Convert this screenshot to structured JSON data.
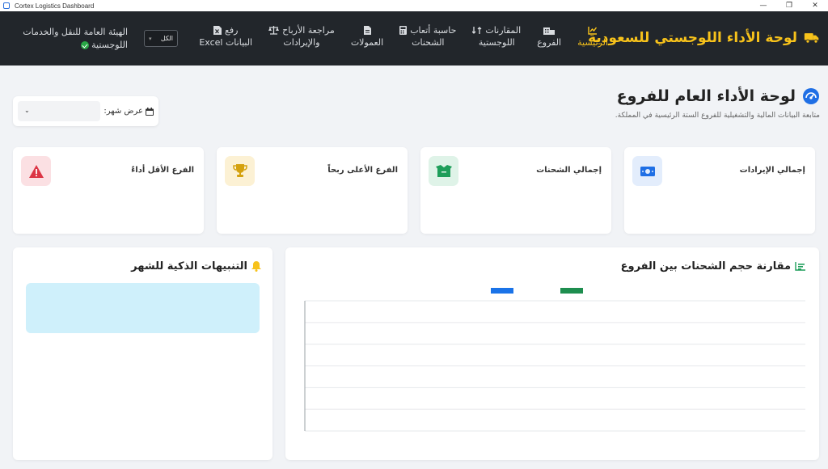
{
  "window": {
    "title": "Cortex Logistics Dashboard",
    "minimize": "—",
    "maximize": "❐",
    "close": "✕"
  },
  "header": {
    "brand_title": "لوحة الأداء اللوجستي للسعودية",
    "brand_icon": "truck-icon",
    "nav": [
      {
        "label": "الرئيسية",
        "icon": "chart-line-icon",
        "active": true
      },
      {
        "label": "الفروع",
        "icon": "building-icon",
        "active": false
      },
      {
        "label_line1": "المقارنات",
        "label_line2": "اللوجستية",
        "icon": "swap-icon",
        "active": false
      },
      {
        "label_line1": "حاسبة أتعاب",
        "label_line2": "الشحنات",
        "icon": "calculator-icon",
        "active": false
      },
      {
        "label_line1": "",
        "label_line2": "العمولات",
        "icon": "file-icon",
        "active": false
      },
      {
        "label_line1": "مراجعة الأرباح",
        "label_line2": "والإيرادات",
        "icon": "scale-icon",
        "active": false
      },
      {
        "label_line1": "رفع",
        "label_line2": "البيانات Excel",
        "icon": "file-excel-icon",
        "active": false
      }
    ],
    "filter_value": "الكل",
    "org_line1": "الهيئة العامة للنقل والخدمات",
    "org_line2": "اللوجستية"
  },
  "page": {
    "title": "لوحة الأداء العام للفروع",
    "subtitle": "متابعة البيانات المالية والتشغيلية للفروع الستة الرئيسية في المملكة.",
    "month_label": "عرض شهر:",
    "month_value": ""
  },
  "kpis": [
    {
      "label": "إجمالي الإيرادات",
      "icon": "money-icon",
      "color": "#1f6fe5",
      "bg": "#e3edfc",
      "value": ""
    },
    {
      "label": "إجمالي الشحنات",
      "icon": "box-open-icon",
      "color": "#1e9e5a",
      "bg": "#dff3e8",
      "value": ""
    },
    {
      "label": "الفرع الأعلى ربحاً",
      "icon": "trophy-icon",
      "color": "#d4a10f",
      "bg": "#fcf1d4",
      "value": ""
    },
    {
      "label": "الفرع الأقل أداءً",
      "icon": "warning-icon",
      "color": "#dc3545",
      "bg": "#fbe0e3",
      "value": ""
    }
  ],
  "alerts": {
    "title": "التنبيهات الذكية للشهر"
  },
  "chart": {
    "title": "مقارنة حجم الشحنات بين الفروع"
  },
  "chart_data": {
    "type": "bar",
    "title": "مقارنة حجم الشحنات بين الفروع",
    "categories": [],
    "series": [
      {
        "color": "#1a73e8",
        "values": []
      },
      {
        "color": "#1e8e4f",
        "values": []
      }
    ],
    "grid": true,
    "legend": "top"
  },
  "colors": {
    "accent": "#f7c21b",
    "header_bg": "#22262b",
    "page_bg": "#f1f3f6"
  }
}
